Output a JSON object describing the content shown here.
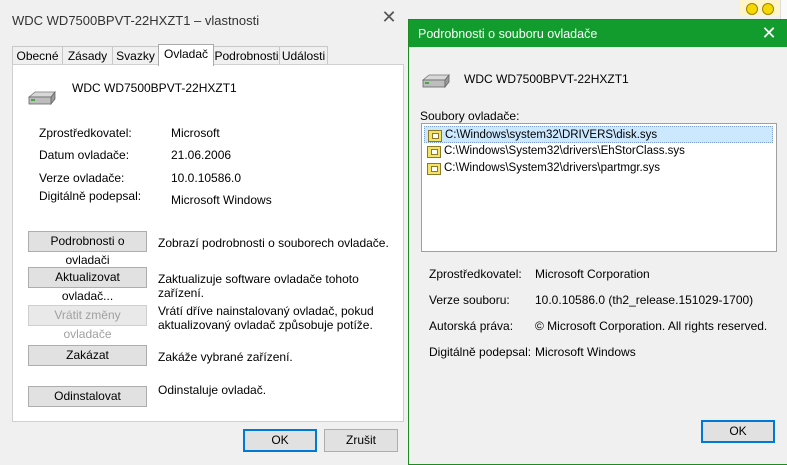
{
  "main_window": {
    "title": "WDC WD7500BPVT-22HXZT1 – vlastnosti",
    "close_glyph": "✕",
    "tabs": [
      {
        "label": "Obecné"
      },
      {
        "label": "Zásady"
      },
      {
        "label": "Svazky"
      },
      {
        "label": "Ovladač"
      },
      {
        "label": "Podrobnosti"
      },
      {
        "label": "Události"
      }
    ],
    "active_tab": "Ovladač",
    "device_name": "WDC WD7500BPVT-22HXZT1",
    "props": {
      "provider_label": "Zprostředkovatel:",
      "provider_value": "Microsoft",
      "date_label": "Datum ovladače:",
      "date_value": "21.06.2006",
      "version_label": "Verze ovladače:",
      "version_value": "10.0.10586.0",
      "signer_label": "Digitálně podepsal:",
      "signer_value": "Microsoft Windows"
    },
    "actions": [
      {
        "button": "Podrobnosti o ovladači",
        "desc": "Zobrazí podrobnosti o souborech ovladače."
      },
      {
        "button": "Aktualizovat ovladač...",
        "desc": "Zaktualizuje software ovladače tohoto zařízení."
      },
      {
        "button": "Vrátit změny ovladače",
        "desc1": "Vrátí dříve nainstalovaný ovladač, pokud",
        "desc2": "aktualizovaný ovladač způsobuje potíže."
      },
      {
        "button": "Zakázat",
        "desc": "Zakáže vybrané zařízení."
      },
      {
        "button": "Odinstalovat",
        "desc": "Odinstaluje ovladač."
      }
    ],
    "ok_label": "OK",
    "cancel_label": "Zrušit"
  },
  "dialog": {
    "title": "Podrobnosti o souboru ovladače",
    "close_glyph": "✕",
    "device_name": "WDC WD7500BPVT-22HXZT1",
    "files_label": "Soubory ovladače:",
    "files": [
      "C:\\Windows\\system32\\DRIVERS\\disk.sys",
      "C:\\Windows\\System32\\drivers\\EhStorClass.sys",
      "C:\\Windows\\System32\\drivers\\partmgr.sys"
    ],
    "selected_file_index": 0,
    "provider_label": "Zprostředkovatel:",
    "provider_value": "Microsoft Corporation",
    "file_version_label": "Verze souboru:",
    "file_version_value": "10.0.10586.0 (th2_release.151029-1700)",
    "copyright_label": "Autorská práva:",
    "copyright_value": "© Microsoft Corporation. All rights reserved.",
    "signer_label": "Digitálně podepsal:",
    "signer_value": "Microsoft Windows",
    "ok_label": "OK"
  },
  "colors": {
    "dialog_titlebar": "#129c2d",
    "selection": "#cce8ff",
    "default_button_border": "#0078d7"
  }
}
